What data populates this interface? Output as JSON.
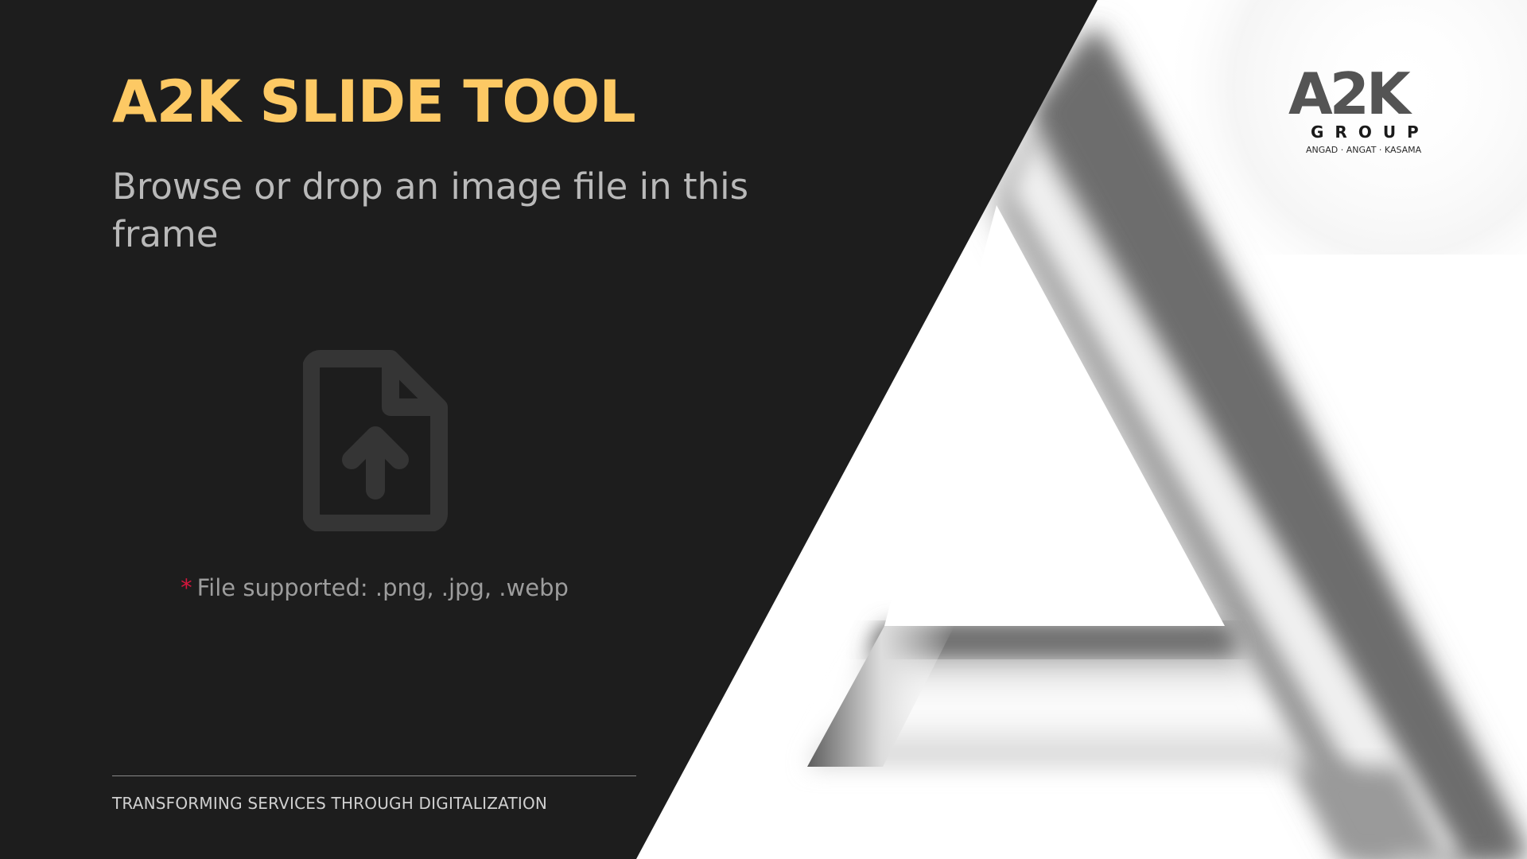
{
  "slide": {
    "title": "A2K SLIDE TOOL",
    "subtitle": "Browse or drop an image file in this frame",
    "upload": {
      "icon": "file-upload-icon",
      "required_marker": "*",
      "supported_text": "File supported: .png, .jpg, .webp"
    },
    "tagline": "TRANSFORMING SERVICES THROUGH DIGITALIZATION"
  },
  "brand": {
    "logo_text": "A2K",
    "group": "GROUP",
    "subtitle": "ANGAD · ANGAT · KASAMA"
  },
  "colors": {
    "background_dark": "#1d1d1d",
    "title_accent": "#fdc964",
    "subtitle_text": "#b9b9b9",
    "icon_gray": "#353535",
    "asterisk_red": "#d4163c",
    "logo_gray": "#545454"
  }
}
